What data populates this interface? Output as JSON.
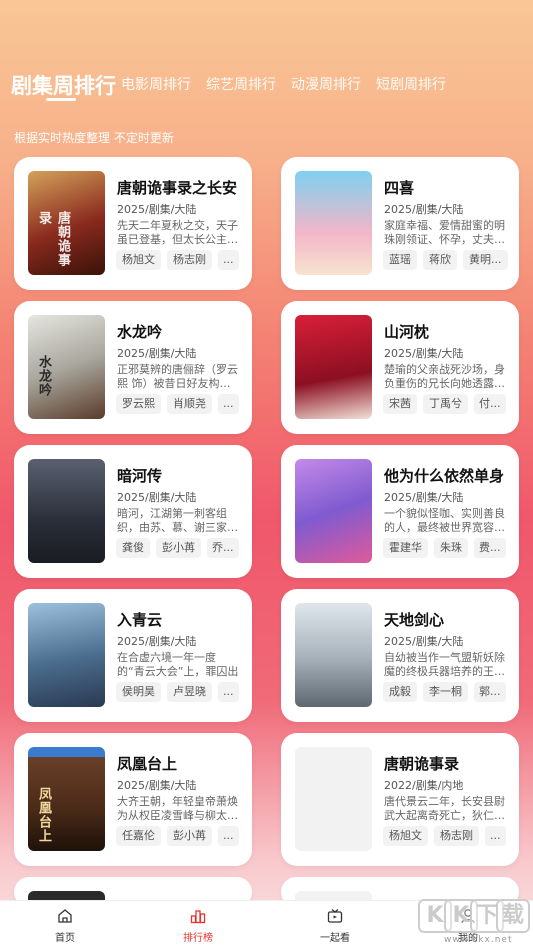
{
  "tabs": [
    "剧集周排行",
    "电影周排行",
    "综艺周排行",
    "动漫周排行",
    "短剧周排行"
  ],
  "subtitle": "根据实时热度整理 不定时更新",
  "cards": [
    {
      "title": "唐朝诡事录之长安",
      "meta": "2025/剧集/大陆",
      "desc": "先天二年夏秋之交，天子虽已登基，但太长公主…",
      "tags": [
        "杨旭文",
        "杨志刚",
        "..."
      ],
      "poster_color": "#8a2a1e",
      "poster_text": "唐朝诡事录"
    },
    {
      "title": "四喜",
      "meta": "2025/剧集/大陆",
      "desc": "家庭幸福、爱情甜蜜的明珠刚领证、怀孕，丈夫…",
      "tags": [
        "蓝瑶",
        "蒋欣",
        "黄明..."
      ],
      "poster_color": "#6cc3e8",
      "poster_text": ""
    },
    {
      "title": "水龙吟",
      "meta": "2025/剧集/大陆",
      "desc": "正邪莫辨的唐俪辞（罗云熙 饰）被昔日好友构…",
      "tags": [
        "罗云熙",
        "肖顺尧",
        "..."
      ],
      "poster_color": "#c9c9c4",
      "poster_text": "水龙吟"
    },
    {
      "title": "山河枕",
      "meta": "2025/剧集/大陆",
      "desc": "楚瑜的父亲战死沙场，身负重伤的兄长向她透露…",
      "tags": [
        "宋茜",
        "丁禹兮",
        "付..."
      ],
      "poster_color": "#b8142a",
      "poster_text": ""
    },
    {
      "title": "暗河传",
      "meta": "2025/剧集/大陆",
      "desc": "暗河，江湖第一刺客组织，由苏、慕、谢三家…",
      "tags": [
        "龚俊",
        "彭小苒",
        "乔..."
      ],
      "poster_color": "#3b4250",
      "poster_text": ""
    },
    {
      "title": "他为什么依然单身",
      "meta": "2025/剧集/大陆",
      "desc": "一个貌似怪咖、实则善良的人，最终被世界宽容…",
      "tags": [
        "霍建华",
        "朱珠",
        "费..."
      ],
      "poster_color": "#9a6fd0",
      "poster_text": ""
    },
    {
      "title": "入青云",
      "meta": "2025/剧集/大陆",
      "desc": "在合虚六境一年一度的“青云大会”上，罪囚出身的…",
      "tags": [
        "侯明昊",
        "卢昱晓",
        "..."
      ],
      "poster_color": "#4a6c8c",
      "poster_text": ""
    },
    {
      "title": "天地剑心",
      "meta": "2025/剧集/大陆",
      "desc": "自幼被当作一气盟斩妖除魔的终极兵器培养的王…",
      "tags": [
        "成毅",
        "李一桐",
        "郭..."
      ],
      "poster_color": "#aab5bd",
      "poster_text": ""
    },
    {
      "title": "凤凰台上",
      "meta": "2025/剧集/大陆",
      "desc": "大齐王朝，年轻皇帝萧焕为从权臣凌雪峰与柳太…",
      "tags": [
        "任嘉伦",
        "彭小苒",
        "..."
      ],
      "poster_color": "#4a2a18",
      "poster_text": "凤凰台上"
    },
    {
      "title": "唐朝诡事录",
      "meta": "2022/剧集/内地",
      "desc": "唐代景云二年，长安县尉武大起离奇死亡，狄仁…",
      "tags": [
        "杨旭文",
        "杨志刚",
        "..."
      ],
      "poster_color": "#f2f2f2",
      "poster_text": ""
    }
  ],
  "nav": [
    {
      "label": "首页",
      "icon": "home-icon"
    },
    {
      "label": "排行榜",
      "icon": "ranking-icon"
    },
    {
      "label": "一起看",
      "icon": "tv-icon"
    },
    {
      "label": "我的",
      "icon": "user-icon"
    }
  ],
  "watermark": {
    "chars": [
      "K",
      "K",
      "下",
      "载"
    ],
    "url": "www.kkx.net"
  }
}
